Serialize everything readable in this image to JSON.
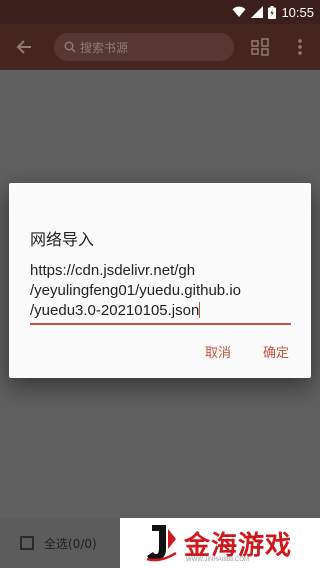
{
  "status_bar": {
    "time": "10:55"
  },
  "app_bar": {
    "search_placeholder": "搜索书源"
  },
  "dialog": {
    "title": "网络导入",
    "input_lines": [
      "https://cdn.jsdelivr.net/gh",
      "/yeyulingfeng01/yuedu.github.io",
      "/yuedu3.0-20210105.json"
    ],
    "cancel_label": "取消",
    "ok_label": "确定"
  },
  "bottom_bar": {
    "select_all_label": "全选(0/0)"
  },
  "watermark": {
    "brand_text": "金海游戏",
    "url": "WWW.JINHAI888.COM"
  },
  "colors": {
    "accent": "#c7513e",
    "appbar": "#47251f",
    "statusbar": "#3a1f1a"
  }
}
